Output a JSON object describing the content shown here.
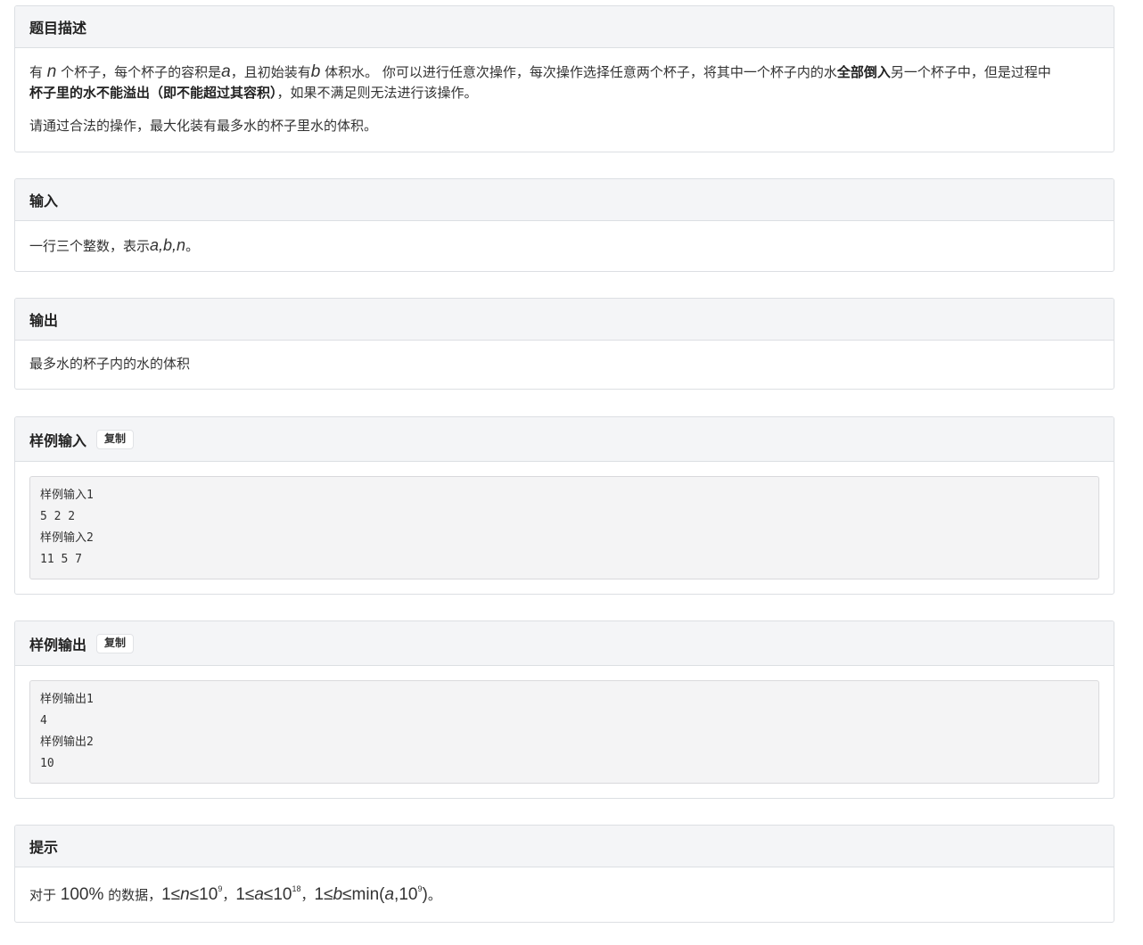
{
  "description": {
    "title": "题目描述",
    "p1_pre": "有 ",
    "p1_n": "n",
    "p1_a_pre": " 个杯子，每个杯子的容积是",
    "p1_a": "a",
    "p1_b_pre": "，且初始装有",
    "p1_b": "b",
    "p1_mid": " 体积水。 你可以进行任意次操作，每次操作选择任意两个杯子，将其中一个杯子内的水",
    "p1_bold1": "全部倒入",
    "p1_mid2": "另一个杯子中，但是过程中",
    "p1_bold2": "杯子里的水不能溢出（即不能超过其容积）",
    "p1_end": "，如果不满足则无法进行该操作。",
    "p2": "请通过合法的操作，最大化装有最多水的杯子里水的体积。"
  },
  "input": {
    "title": "输入",
    "text_pre": "一行三个整数，表示",
    "vars": "a,b,n",
    "text_end": "。"
  },
  "output": {
    "title": "输出",
    "text": "最多水的杯子内的水的体积"
  },
  "sample_input": {
    "title": "样例输入",
    "copy_label": "复制",
    "lines": [
      "样例输入1",
      "5 2 2",
      "样例输入2",
      "11 5 7"
    ]
  },
  "sample_output": {
    "title": "样例输出",
    "copy_label": "复制",
    "lines": [
      "样例输出1",
      "4",
      "样例输出2",
      "10"
    ]
  },
  "hint": {
    "title": "提示",
    "pre": "对于 ",
    "percent": "100%",
    "mid": " 的数据，",
    "c1_a": "1≤",
    "c1_var": "n",
    "c1_b": "≤10",
    "c1_exp": "9",
    "sep1": "，",
    "c2_a": "1≤",
    "c2_var": "a",
    "c2_b": "≤10",
    "c2_exp": "18",
    "sep2": "，",
    "c3_a": "1≤",
    "c3_var": "b",
    "c3_b": "≤min(",
    "c3_var2": "a",
    "c3_c": ",10",
    "c3_exp": "9",
    "c3_d": ")",
    "end": "。"
  }
}
